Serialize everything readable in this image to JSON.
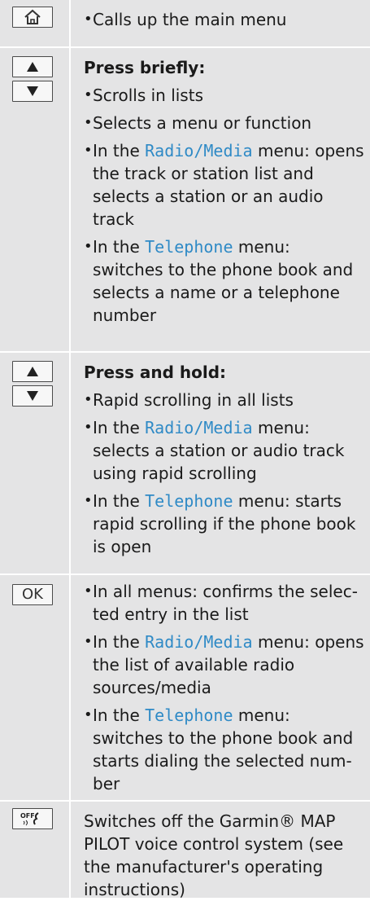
{
  "rows": [
    {
      "keys": [
        "home-icon"
      ],
      "items": [
        {
          "text": "Calls up the main menu"
        }
      ]
    },
    {
      "keys": [
        "up-arrow-icon",
        "down-arrow-icon"
      ],
      "heading": "Press briefly:",
      "items": [
        {
          "text": "Scrolls in lists"
        },
        {
          "text": "Selects a menu or function"
        },
        {
          "pre": "In the ",
          "m1": "Radio",
          "sep": "/",
          "m2": "Media",
          "post": " menu: opens the track or station list and selects a station or an audio track"
        },
        {
          "pre": "In the ",
          "m1": "Telephone",
          "post": " menu: switches to the phone book and selects a name or a telephone number"
        }
      ]
    },
    {
      "keys": [
        "up-arrow-icon",
        "down-arrow-icon"
      ],
      "heading": "Press and hold:",
      "items": [
        {
          "text": "Rapid scrolling in all lists"
        },
        {
          "pre": "In the ",
          "m1": "Radio",
          "sep": "/",
          "m2": "Media",
          "post": " menu: selects a station or audio track using rapid scrolling"
        },
        {
          "pre": "In the ",
          "m1": "Telephone",
          "post": " menu: starts rapid scrolling if the phone book is open"
        }
      ]
    },
    {
      "keys": [
        "ok-key"
      ],
      "ok_label": "OK",
      "items": [
        {
          "text": "In all menus: confirms the selec-ted entry in the list"
        },
        {
          "pre": "In the ",
          "m1": "Radio",
          "sep": "/",
          "m2": "Media",
          "post": " menu: opens the list of available radio sources/media"
        },
        {
          "pre": "In the ",
          "m1": "Telephone",
          "post": " menu: switches to the phone book and starts dialing the selected num-ber"
        }
      ]
    },
    {
      "keys": [
        "voice-off-icon"
      ],
      "voice_key_text": "OFF",
      "plain_text": "Switches off the Garmin® MAP PILOT voice control system (see the manufacturer's operating instructions)"
    }
  ],
  "colors": {
    "table_bg": "#e4e4e5",
    "menu_link": "#2f8ac6"
  }
}
